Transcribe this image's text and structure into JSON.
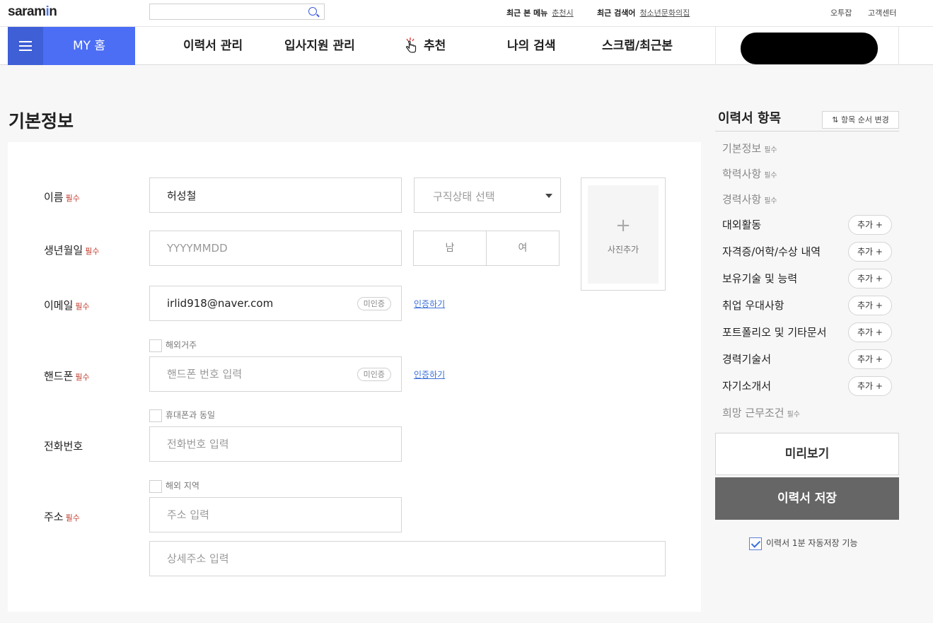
{
  "top": {
    "logo": "saramin",
    "search_placeholder": "",
    "recent_menu_label": "최근 본 메뉴",
    "recent_menu_value": "춘천시",
    "recent_search_label": "최근 검색어",
    "recent_search_value": "청소년문화의집",
    "links": [
      "오투잡",
      "고객센터"
    ]
  },
  "nav": {
    "home": "MY 홈",
    "items": [
      "이력서 관리",
      "입사지원 관리",
      "추천",
      "나의 검색",
      "스크랩/최근본"
    ]
  },
  "page": {
    "title": "기본정보"
  },
  "form": {
    "required_mark": "필수",
    "name": {
      "label": "이름",
      "value": "허성철"
    },
    "job_status": {
      "placeholder": "구직상태 선택"
    },
    "birth": {
      "label": "생년월일",
      "placeholder": "YYYYMMDD"
    },
    "gender": [
      "남",
      "여"
    ],
    "photo": {
      "plus": "+",
      "label": "사진추가"
    },
    "email": {
      "label": "이메일",
      "value": "irlid918@naver.com",
      "badge": "미인증",
      "verify": "인증하기"
    },
    "overseas_resident": "해외거주",
    "phone": {
      "label": "핸드폰",
      "placeholder": "핸드폰 번호 입력",
      "badge": "미인증",
      "verify": "인증하기"
    },
    "same_as_mobile": "휴대폰과 동일",
    "tel": {
      "label": "전화번호",
      "placeholder": "전화번호 입력"
    },
    "overseas_area": "해외 지역",
    "address": {
      "label": "주소",
      "placeholder": "주소 입력",
      "detail_placeholder": "상세주소 입력"
    }
  },
  "sidebar": {
    "title": "이력서 항목",
    "order_button": "항목 순서 변경",
    "required_mark": "필수",
    "add_label": "추가",
    "items": [
      {
        "label": "기본정보",
        "required": true
      },
      {
        "label": "학력사항",
        "required": true
      },
      {
        "label": "경력사항",
        "required": true
      },
      {
        "label": "대외활동",
        "required": false
      },
      {
        "label": "자격증/어학/수상 내역",
        "required": false
      },
      {
        "label": "보유기술 및 능력",
        "required": false
      },
      {
        "label": "취업 우대사항",
        "required": false
      },
      {
        "label": "포트폴리오 및 기타문서",
        "required": false
      },
      {
        "label": "경력기술서",
        "required": false
      },
      {
        "label": "자기소개서",
        "required": false
      },
      {
        "label": "희망 근무조건",
        "required": true
      }
    ],
    "preview": "미리보기",
    "save": "이력서 저장",
    "autosave": "이력서 1분 자동저장 기능",
    "autosave_checked": true
  },
  "colors": {
    "brand_blue": "#4c6ef5",
    "link_blue": "#3a6fd8",
    "required_red": "#c0392b",
    "save_gray": "#666666"
  }
}
